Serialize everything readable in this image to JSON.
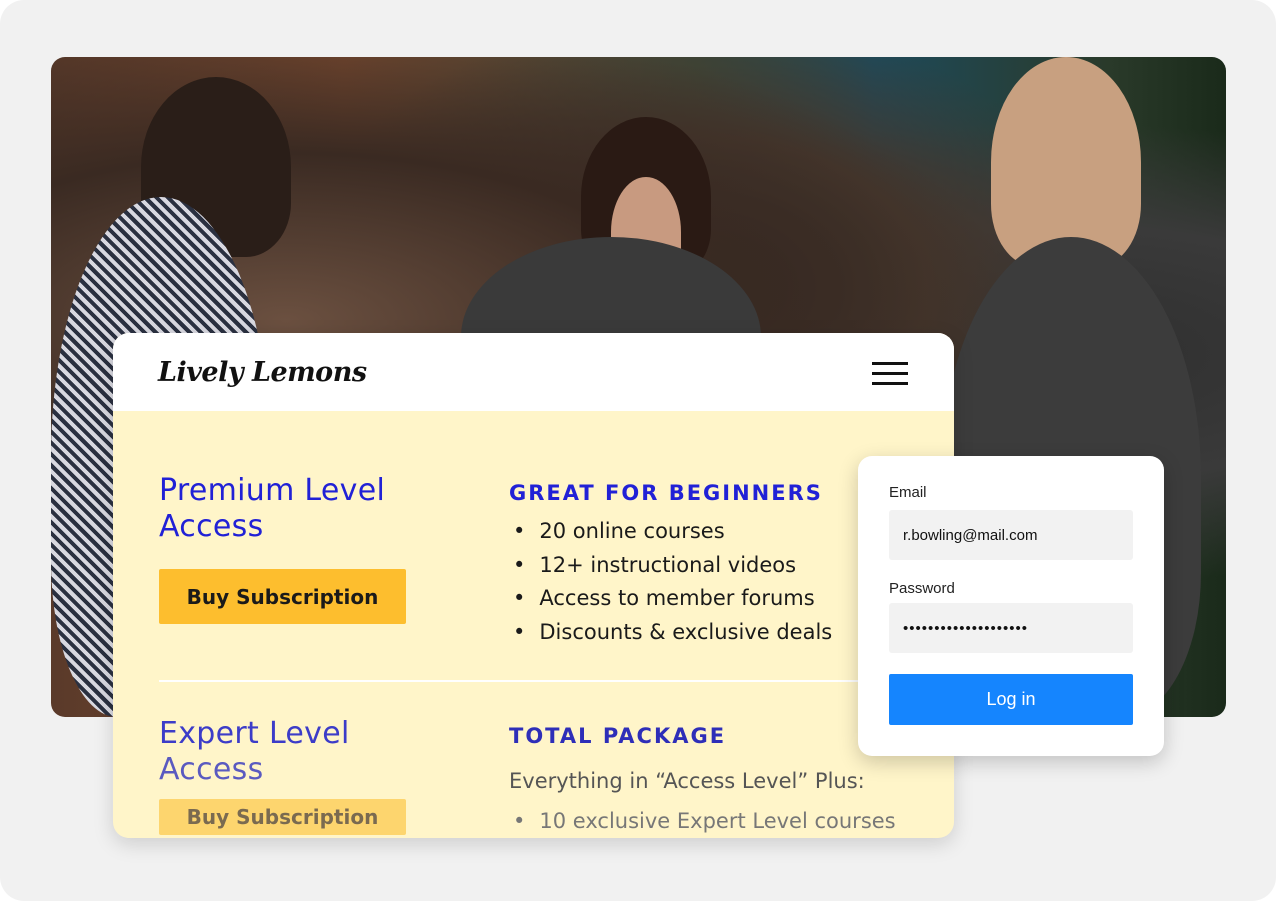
{
  "brand": {
    "logo": "Lively Lemons"
  },
  "plans": [
    {
      "title_line1": "Premium Level",
      "title_line2": "Access",
      "button": "Buy Subscription",
      "subtitle": "GREAT FOR BEGINNERS",
      "features": [
        "20 online courses",
        "12+ instructional videos",
        "Access to member forums",
        "Discounts & exclusive deals"
      ]
    },
    {
      "title_line1": "Expert Level",
      "title_line2": "Access",
      "button": "Buy Subscription",
      "subtitle": "TOTAL PACKAGE",
      "intro": "Everything in “Access Level” Plus:",
      "features": [
        "10 exclusive Expert Level courses"
      ]
    }
  ],
  "login": {
    "email_label": "Email",
    "email_value": "r.bowling@mail.com",
    "password_label": "Password",
    "password_value": "••••••••••••••••••••",
    "button": "Log in"
  },
  "colors": {
    "accent": "#2121d6",
    "button": "#fdbe2e",
    "login": "#1585fe",
    "card_bg": "#fff5c9"
  }
}
